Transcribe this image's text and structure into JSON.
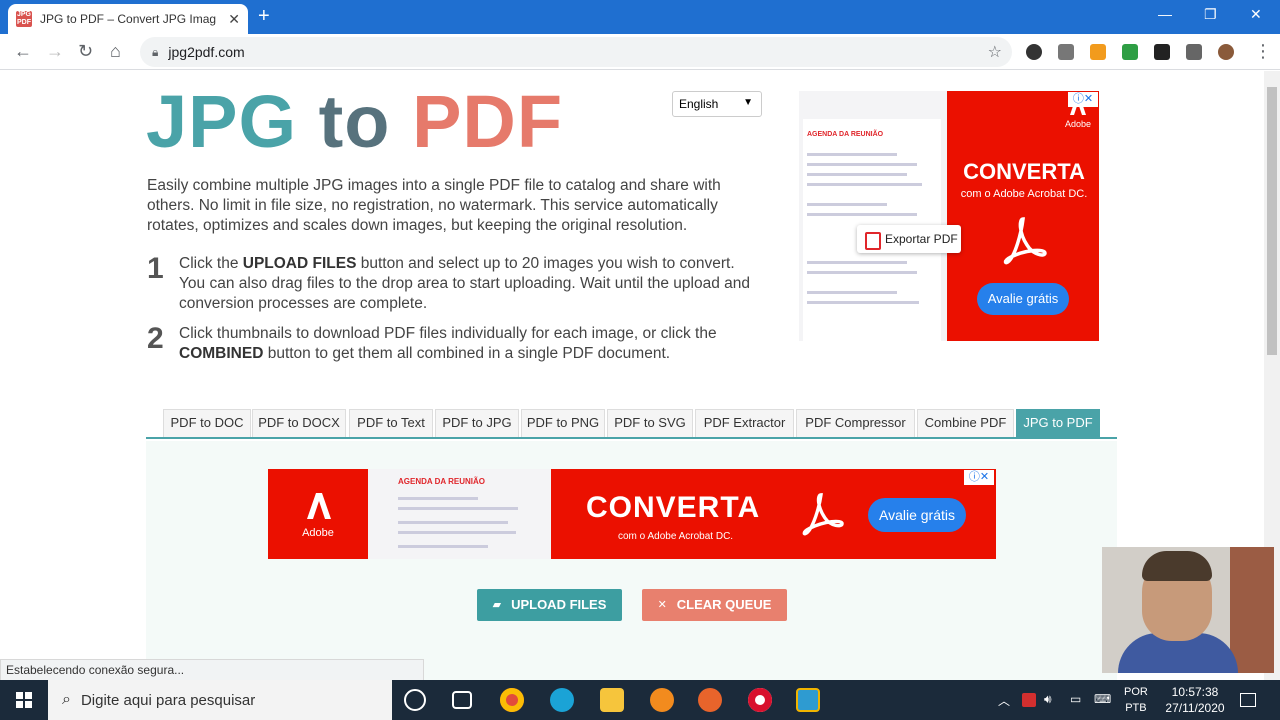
{
  "browser": {
    "tab_title": "JPG to PDF – Convert JPG Images",
    "favicon_text": "JPG PDF",
    "url": "jpg2pdf.com",
    "status": "Estabelecendo conexão segura..."
  },
  "page": {
    "logo": {
      "part1": "JPG",
      "part2": "to",
      "part3": "PDF"
    },
    "language": "English",
    "intro": "Easily combine multiple JPG images into a single PDF file to catalog and share with others. No limit in file size, no registration, no watermark. This service automatically rotates, optimizes and scales down images, but keeping the original resolution.",
    "steps": [
      {
        "num": "1",
        "pre": "Click the ",
        "bold": "UPLOAD FILES",
        "post": " button and select up to 20 images you wish to convert. You can also drag files to the drop area to start uploading. Wait until the upload and conversion processes are complete."
      },
      {
        "num": "2",
        "pre": "Click thumbnails to download PDF files individually for each image, or click the ",
        "bold": "COMBINED",
        "post": " button to get them all combined in a single PDF document."
      }
    ],
    "tabs": [
      "PDF to DOC",
      "PDF to DOCX",
      "PDF to Text",
      "PDF to JPG",
      "PDF to PNG",
      "PDF to SVG",
      "PDF Extractor",
      "PDF Compressor",
      "Combine PDF",
      "JPG to PDF"
    ],
    "active_tab": "JPG to PDF",
    "upload_label": "UPLOAD FILES",
    "clear_label": "CLEAR QUEUE"
  },
  "ads": {
    "brand": "Adobe",
    "doc_title": "AGENDA DA REUNIÃO",
    "headline": "CONVERTA",
    "subline": "com o Adobe Acrobat DC.",
    "export_label": "Exportar PDF",
    "cta": "Avalie grátis"
  },
  "taskbar": {
    "search_placeholder": "Digite aqui para pesquisar",
    "lang_line1": "POR",
    "lang_line2": "PTB",
    "time": "10:57:38",
    "date": "27/11/2020"
  },
  "colors": {
    "accent_teal": "#4aa3a8",
    "logo_pdf": "#e67a6b",
    "ad_red": "#eb1000",
    "cta_blue": "#2680eb"
  }
}
